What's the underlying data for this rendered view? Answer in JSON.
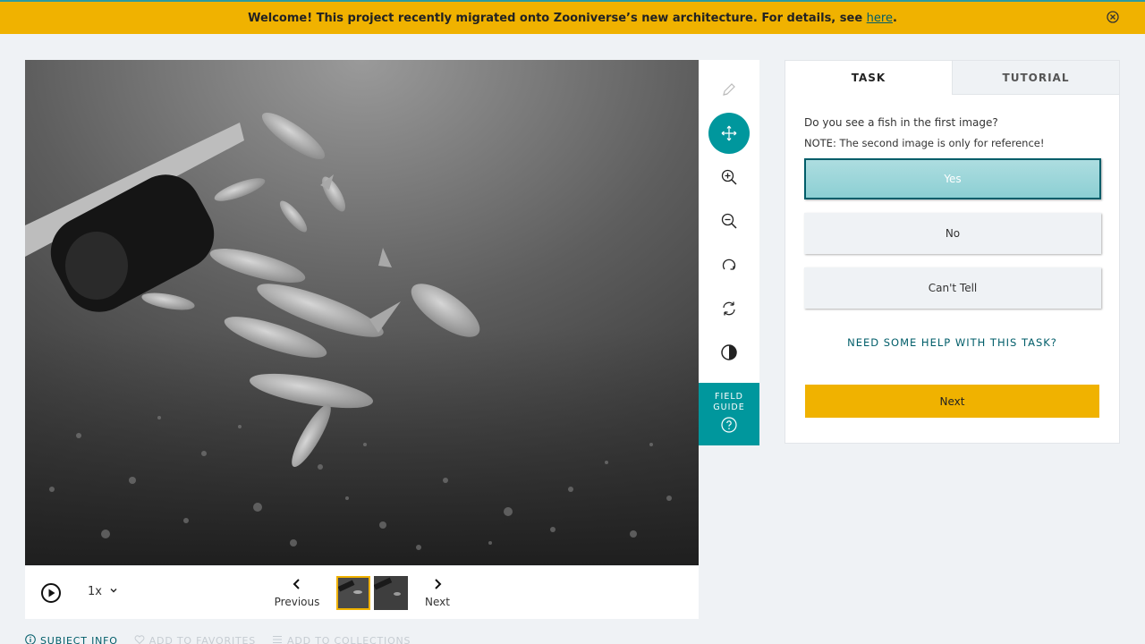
{
  "banner": {
    "message": "Welcome! This project recently migrated onto Zooniverse’s new architecture. For details, see ",
    "link_text": "here",
    "end": "."
  },
  "toolbar": {
    "tools": [
      "pencil-icon",
      "move-icon",
      "zoom-in-icon",
      "zoom-out-icon",
      "rotate-icon",
      "reset-icon",
      "invert-icon"
    ],
    "active_tool": "move-icon",
    "field_guide_label": "FIELD\nGUIDE"
  },
  "controls": {
    "speed": "1x",
    "previous_label": "Previous",
    "next_label": "Next",
    "frames": 2,
    "selected_frame": 1
  },
  "meta": {
    "subject_info": "SUBJECT INFO",
    "add_favorites": "ADD TO FAVORITES",
    "add_collections": "ADD TO COLLECTIONS"
  },
  "task": {
    "tabs": [
      "TASK",
      "TUTORIAL"
    ],
    "active_tab": "TASK",
    "question": "Do you see a fish in the first image?",
    "note": "NOTE: The second image is only for reference!",
    "answers": [
      "Yes",
      "No",
      "Can't Tell"
    ],
    "selected_answer": "Yes",
    "help_link": "NEED SOME HELP WITH THIS TASK?",
    "next_label": "Next"
  },
  "colors": {
    "accent": "#00979d",
    "banner": "#f0b200",
    "link": "#005d69"
  }
}
